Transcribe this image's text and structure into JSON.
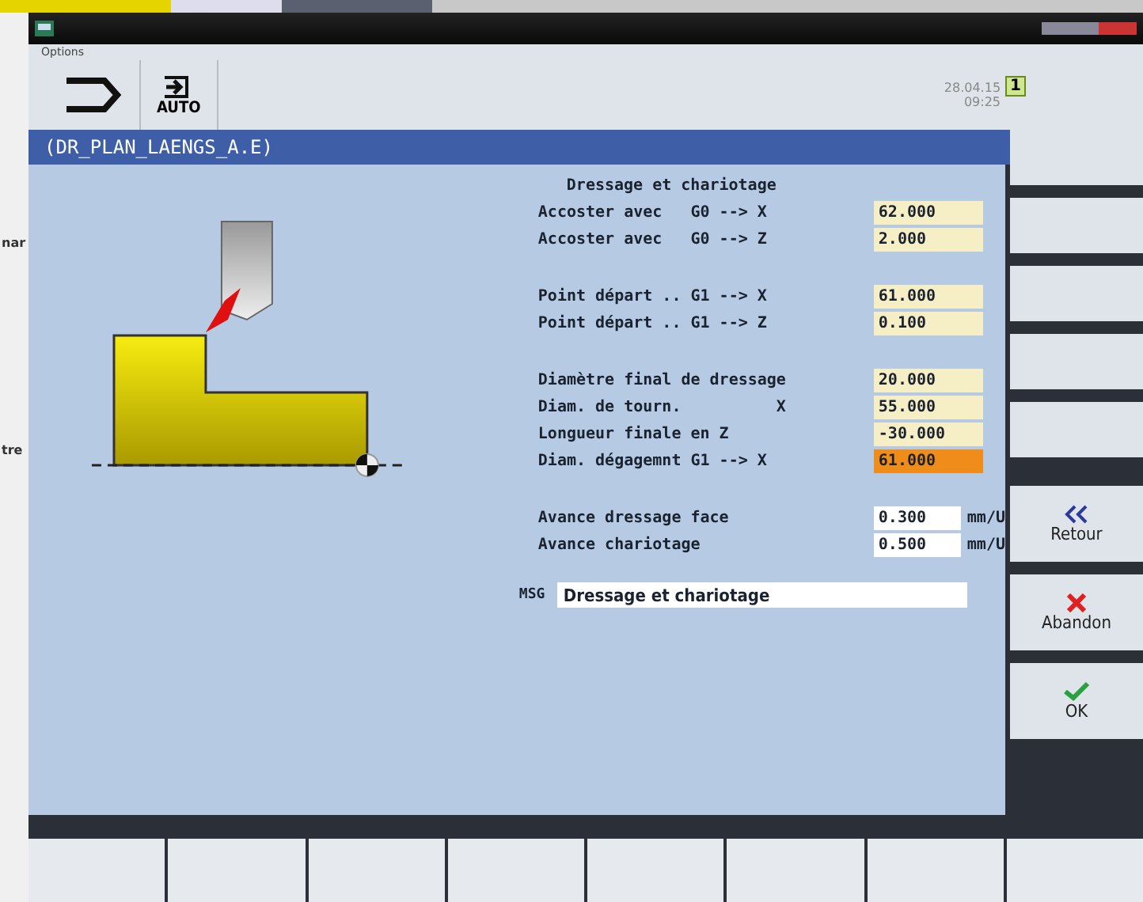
{
  "background_window": {
    "fragments": [
      "nar",
      "tre"
    ]
  },
  "window": {
    "menu": "Options"
  },
  "toolbar": {
    "mode": "AUTO",
    "date": "28.04.15",
    "time": "09:25",
    "channel": "1"
  },
  "cycle": {
    "title": "(DR_PLAN_LAENGS_A.E)"
  },
  "form": {
    "heading": "Dressage et chariotage",
    "groups": [
      {
        "rows": [
          {
            "label": "Accoster avec   G0 --> X",
            "value": "62.000",
            "kind": "select",
            "selected": false
          },
          {
            "label": "Accoster avec   G0 --> Z",
            "value": "2.000",
            "kind": "select",
            "selected": false
          }
        ]
      },
      {
        "rows": [
          {
            "label": "Point départ .. G1 --> X",
            "value": "61.000",
            "kind": "select",
            "selected": false
          },
          {
            "label": "Point départ .. G1 --> Z",
            "value": "0.100",
            "kind": "select",
            "selected": false
          }
        ]
      },
      {
        "rows": [
          {
            "label": "Diamètre final de dressage",
            "value": "20.000",
            "kind": "select",
            "selected": false
          },
          {
            "label": "Diam. de tourn.          X",
            "value": "55.000",
            "kind": "select",
            "selected": false
          },
          {
            "label": "Longueur finale en Z",
            "value": "-30.000",
            "kind": "select",
            "selected": false
          },
          {
            "label": "Diam. dégagemnt G1 --> X",
            "value": "61.000",
            "kind": "select",
            "selected": true
          }
        ]
      },
      {
        "rows": [
          {
            "label": "Avance dressage face",
            "value": "0.300",
            "unit": "mm/U",
            "kind": "input",
            "selected": false
          },
          {
            "label": "Avance chariotage",
            "value": "0.500",
            "unit": "mm/U",
            "kind": "input",
            "selected": false
          }
        ]
      }
    ]
  },
  "msg": {
    "label": "MSG",
    "value": "Dressage et chariotage"
  },
  "softkeys_right": [
    {
      "label": "Retour",
      "kind": "back"
    },
    {
      "label": "Abandon",
      "kind": "cancel"
    },
    {
      "label": "OK",
      "kind": "ok"
    }
  ]
}
